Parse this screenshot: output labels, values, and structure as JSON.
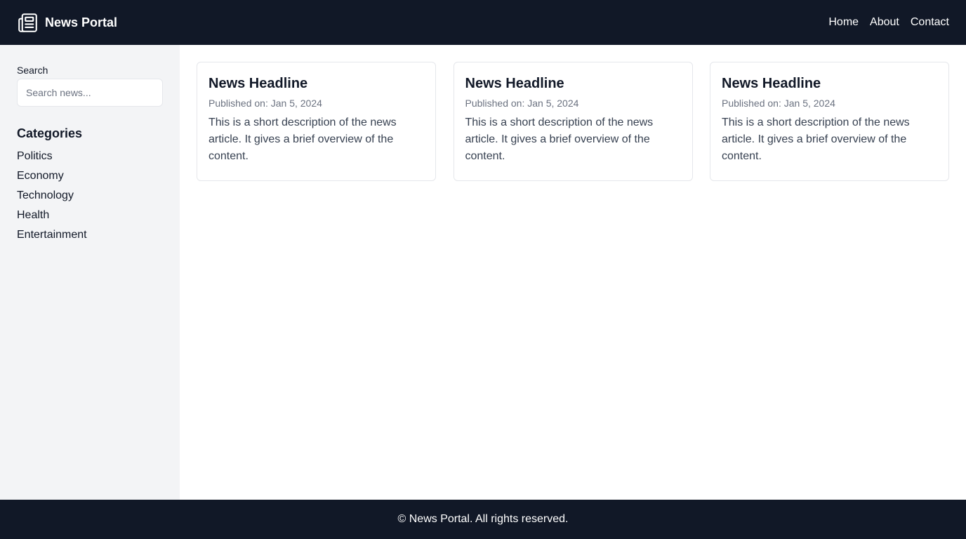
{
  "header": {
    "brand_icon": "newspaper-icon",
    "title": "News Portal",
    "nav": [
      "Home",
      "About",
      "Contact"
    ]
  },
  "sidebar": {
    "search_label": "Search",
    "search_placeholder": "Search news...",
    "search_value": "",
    "categories_title": "Categories",
    "categories": [
      "Politics",
      "Economy",
      "Technology",
      "Health",
      "Entertainment"
    ]
  },
  "articles": [
    {
      "title": "News Headline",
      "date": "Published on: Jan 5, 2024",
      "description": "This is a short description of the news article. It gives a brief overview of the content."
    },
    {
      "title": "News Headline",
      "date": "Published on: Jan 5, 2024",
      "description": "This is a short description of the news article. It gives a brief overview of the content."
    },
    {
      "title": "News Headline",
      "date": "Published on: Jan 5, 2024",
      "description": "This is a short description of the news article. It gives a brief overview of the content."
    }
  ],
  "footer": {
    "text": "© News Portal. All rights reserved."
  },
  "colors": {
    "header_bg": "#111827",
    "sidebar_bg": "#f3f4f6",
    "muted_text": "#6b7280",
    "body_text": "#374151"
  }
}
